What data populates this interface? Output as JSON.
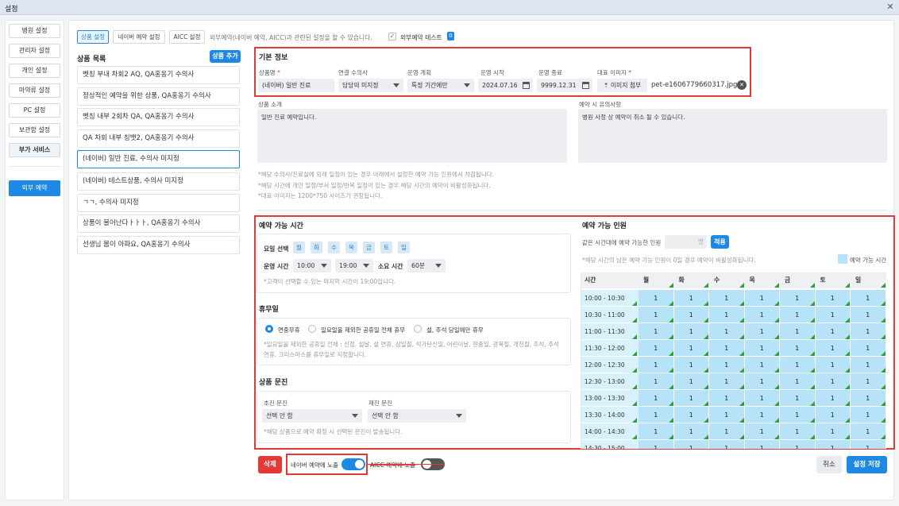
{
  "window": {
    "title": "설정",
    "close": "✕"
  },
  "sidebar": {
    "items": [
      "병원 설정",
      "관리자 설정",
      "개인 설정",
      "마약류 설정",
      "PC 설정",
      "보관함 설정",
      "부가 서비스"
    ],
    "external": "외부 예약"
  },
  "tabs": [
    "상품 설정",
    "네이버 예약 설정",
    "AICC 설정"
  ],
  "tab_desc": "외부예약(네이버 예약, AICC)과 관련된 설정을 할 수 있습니다.",
  "ext_test": {
    "label": "외부예약 테스트",
    "check": "✓",
    "badge": "0"
  },
  "product_list": {
    "title": "상품 목록",
    "add": "상품 추가",
    "items": [
      "벳칭 부내 차회2 AQ, QA홍옹기 수의사",
      "정상적인 예약을 위한 상품, QA홍옹기 수의사",
      "벳칭 내부 2회차 QA, QA홍옹기 수의사",
      "QA 차회 내부 칭뱃2, QA홍옹기 수의사",
      "(네이버) 일반 진료, 수의사 미지정",
      "(네이버) 테스트상품, 수의사 미지정",
      "ㄱㄱ, 수의사 미지정",
      "상품이 불어난다ㅏㅏㅏ, QA홍옹기 수의사",
      "선생님 몸이 아파요, QA홍옹기 수의사"
    ]
  },
  "basic": {
    "title": "기본 정보",
    "labels": {
      "name": "상품명",
      "vet": "연결 수의사",
      "plan": "운영 계획",
      "start": "운영 시작",
      "end": "운영 종료",
      "image": "대표 이미지"
    },
    "req": "*",
    "values": {
      "name": "(네이버) 일반 진료",
      "vet": "담당의 미지정",
      "plan": "특정 기간에만",
      "start": "2024.07.16",
      "end": "9999.12.31",
      "attach": "이미지 첨부",
      "file": "pet-e1606779660317.jpg",
      "clear": "✕",
      "upload": "⇡"
    },
    "intro_label": "상품 소개",
    "intro": "일반 진료 예약입니다.",
    "caution_label": "예약 시 유의사항",
    "caution": "병원 사정 상 예약이 취소 될 수 있습니다.",
    "notes": [
      "*해당 수의사/진료실에 외래 일정이 있는 경우 아래에서 설정한 예약 가능 인원에서 차감됩니다.",
      "*해당 시간에 개인 일정/부서 일정/반복 일정이 있는 경우 해당 시간의 예약이 비활성화됩니다.",
      "*대표 이미지는 1200*750 사이즈가 권장됩니다."
    ]
  },
  "avail": {
    "title": "예약 가능 시간",
    "day_label": "요일 선택",
    "days": [
      "월",
      "화",
      "수",
      "목",
      "금",
      "토",
      "일"
    ],
    "op_label": "운영 시간",
    "op_start": "10:00",
    "op_end": "19:00",
    "dur_label": "소요 시간",
    "dur": "60분",
    "note": "*고객이 선택할 수 있는 마지막 시간이 19:00입니다."
  },
  "holiday": {
    "title": "휴무일",
    "options": [
      "연중무휴",
      "일요일을 제외한 공휴일 전체 휴무",
      "설, 추석 당일에만 휴무"
    ],
    "note": "*일요일을 제외한 공휴일 전체 : 신정, 설날, 설 연휴, 삼일절, 석가탄신일, 어린이날, 현충일, 광복절, 개천절, 추석, 추석 연휴, 크리스마스를 휴무일로 지정합니다."
  },
  "quest": {
    "title": "상품 문진",
    "first_label": "초진 문진",
    "first": "선택 안 함",
    "re_label": "재진 문진",
    "re": "선택 안 함",
    "note": "*해당 상품으로 예약 확정 시 선택된 문진이 발송됩니다."
  },
  "people": {
    "title": "예약 가능 인원",
    "same_label": "같은 시간대에 예약 가능한 인원",
    "unit": "명",
    "apply": "적용",
    "note": "*해당 시간의 남은 예약 가능 인원이 0일 경우 예약이 비활성화됩니다.",
    "legend": "예약 가능 시간",
    "head": [
      "시간",
      "월",
      "화",
      "수",
      "목",
      "금",
      "토",
      "일"
    ],
    "times": [
      "10:00 - 10:30",
      "10:30 - 11:00",
      "11:00 - 11:30",
      "11:30 - 12:00",
      "12:00 - 12:30",
      "12:30 - 13:00",
      "13:00 - 13:30",
      "13:30 - 14:00",
      "14:00 - 14:30",
      "14:30 - 15:00"
    ],
    "value": "1"
  },
  "footer": {
    "delete": "삭제",
    "naver": "네이버 예약에 노출",
    "aicc": "AICC 예약에 노출",
    "cancel": "취소",
    "save": "설정 저장"
  },
  "colors": {
    "accent": "#1e88e5",
    "danger": "#e53935",
    "slot": "#b6e3f7"
  }
}
